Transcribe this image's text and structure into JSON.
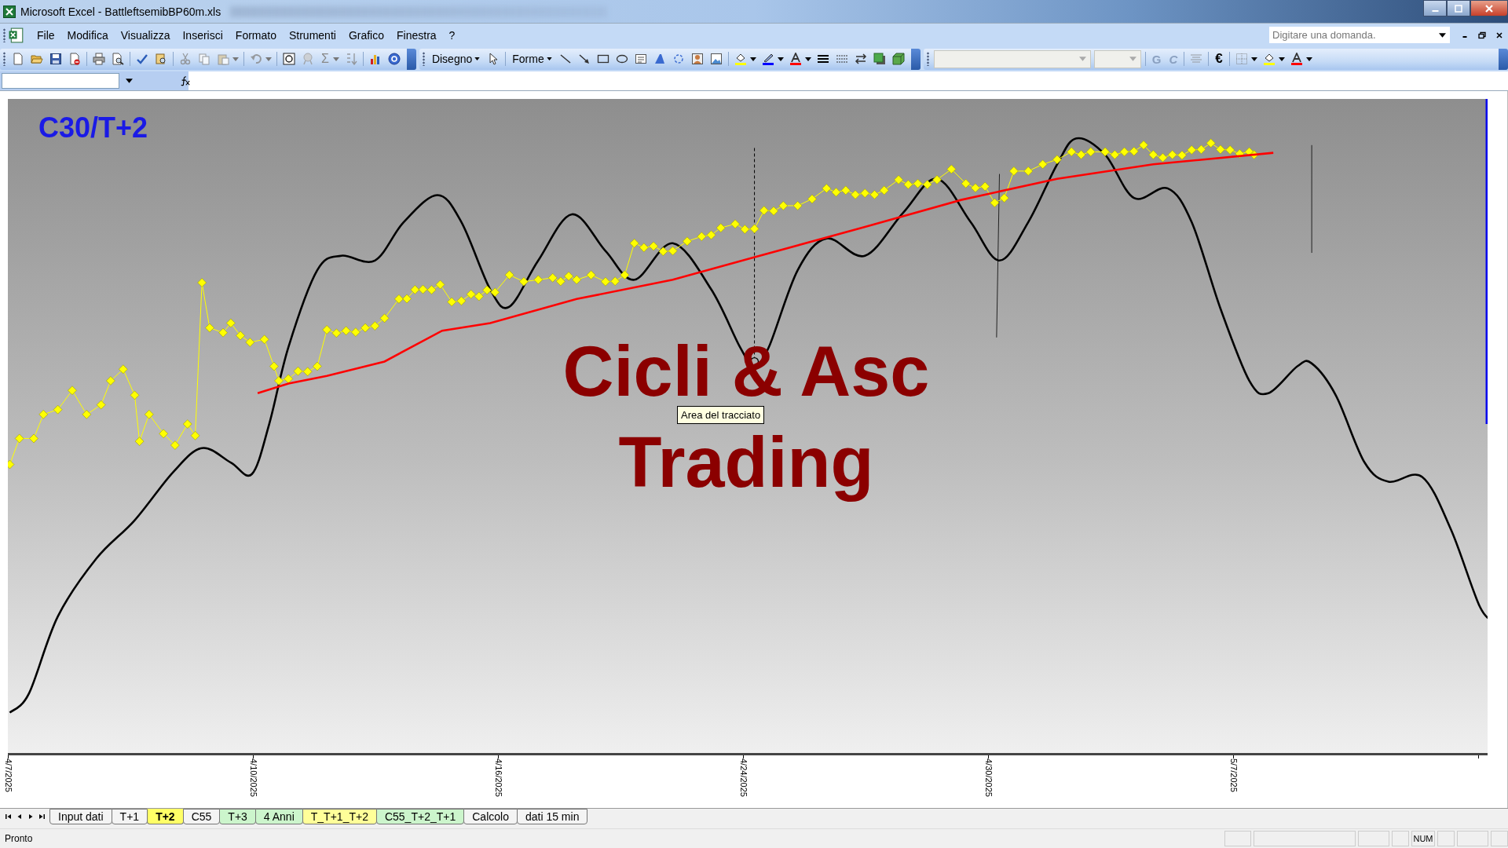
{
  "window": {
    "title": "Microsoft Excel - BattleftsemibBP60m.xls"
  },
  "menu": [
    "File",
    "Modifica",
    "Visualizza",
    "Inserisci",
    "Formato",
    "Strumenti",
    "Grafico",
    "Finestra",
    "?"
  ],
  "help_search": {
    "placeholder": "Digitare una domanda."
  },
  "toolbar": {
    "sum": "Σ",
    "drawing_menu": "Disegno",
    "shapes_menu": "Forme",
    "bold": "G",
    "italic": "C",
    "currency": "€"
  },
  "chart": {
    "title": "C30/T+2",
    "overlay_text": [
      "Cicli & Asc",
      "Trading"
    ],
    "tooltip": "Area del tracciato",
    "x_labels": [
      "4/7/2025",
      "4/10/2025",
      "4/16/2025",
      "4/24/2025",
      "4/30/2025",
      "5/7/2025"
    ]
  },
  "sheet_tabs": [
    {
      "label": "Input dati",
      "selected": false,
      "color": "#f4f4f4"
    },
    {
      "label": "T+1",
      "selected": false,
      "color": "#f4f4f4"
    },
    {
      "label": "T+2",
      "selected": true,
      "color": "#ffff66"
    },
    {
      "label": "C55",
      "selected": false,
      "color": "#f4f4f4"
    },
    {
      "label": "T+3",
      "selected": false,
      "color": "#ccf5cc"
    },
    {
      "label": "4 Anni",
      "selected": false,
      "color": "#ccf5cc"
    },
    {
      "label": "T_T+1_T+2",
      "selected": false,
      "color": "#ffff99"
    },
    {
      "label": "C55_T+2_T+1",
      "selected": false,
      "color": "#ccf5cc"
    },
    {
      "label": "Calcolo",
      "selected": false,
      "color": "#f4f4f4"
    },
    {
      "label": "dati 15 min",
      "selected": false,
      "color": "#f4f4f4"
    }
  ],
  "status_bar": {
    "status": "Pronto",
    "num": "NUM"
  }
}
